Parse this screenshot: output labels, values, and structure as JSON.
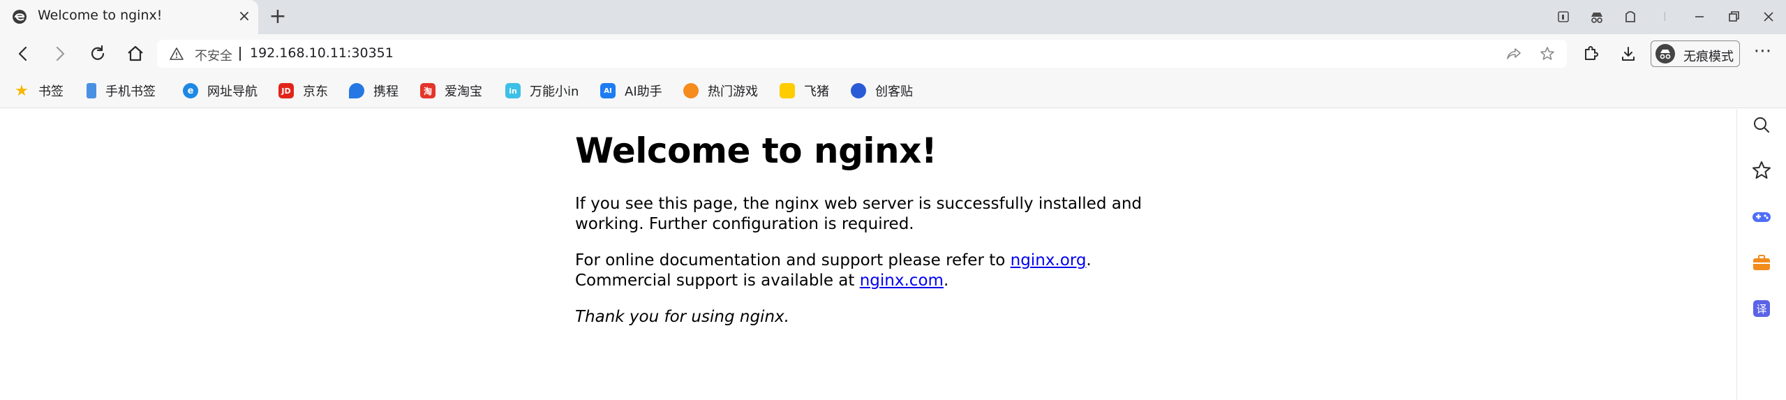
{
  "window": {
    "tab": {
      "title": "Welcome to nginx!",
      "favicon": "edge-favicon-icon",
      "close": "×"
    },
    "new_tab": "+",
    "controls": [
      "workspaces-icon",
      "incognito-mask-icon",
      "extensions-icon",
      "minimize-icon",
      "restore-icon",
      "close-window-icon"
    ]
  },
  "toolbar": {
    "insecure_label": "不安全",
    "url": "192.168.10.11:30351",
    "incognito_label": "无痕模式",
    "more": "⋯"
  },
  "bookmarks": [
    {
      "label": "书签",
      "icon": "star-icon",
      "color": "#f5b700",
      "glyph": "★"
    },
    {
      "label": "手机书签",
      "icon": "phone-bookmark-icon",
      "color": "#4a90e2",
      "glyph": ""
    },
    {
      "label": "网址导航",
      "icon": "edge-icon",
      "color": "#1e88e5",
      "glyph": "e"
    },
    {
      "label": "京东",
      "icon": "jd-icon",
      "color": "#e1251b",
      "glyph": "JD"
    },
    {
      "label": "携程",
      "icon": "ctrip-icon",
      "color": "#2577e3",
      "glyph": ""
    },
    {
      "label": "爱淘宝",
      "icon": "taobao-icon",
      "color": "#e3352b",
      "glyph": "淘"
    },
    {
      "label": "万能小in",
      "icon": "in-icon",
      "color": "#3cc0e6",
      "glyph": "in"
    },
    {
      "label": "AI助手",
      "icon": "ai-assistant-icon",
      "color": "#1d7cf2",
      "glyph": "AI"
    },
    {
      "label": "热门游戏",
      "icon": "games-icon",
      "color": "#f68b1e",
      "glyph": ""
    },
    {
      "label": "飞猪",
      "icon": "fliggy-icon",
      "color": "#ffcc00",
      "glyph": ""
    },
    {
      "label": "创客贴",
      "icon": "chuangkit-icon",
      "color": "#2a5bd7",
      "glyph": ""
    }
  ],
  "page": {
    "heading": "Welcome to nginx!",
    "para1_line1": "If you see this page, the nginx web server is successfully installed and",
    "para1_line2": "working. Further configuration is required.",
    "para2_line1_prefix": "For online documentation and support please refer to ",
    "para2_link1": "nginx.org",
    "para2_line1_suffix": ".",
    "para2_line2_prefix": "Commercial support is available at ",
    "para2_link2": "nginx.com",
    "para2_line2_suffix": ".",
    "para3": "Thank you for using nginx."
  },
  "sidebar": [
    "search-icon",
    "favorites-star-icon",
    "gamepad-icon",
    "toolbox-icon",
    "translate-icon"
  ],
  "colors": {
    "link": "#0000ee",
    "tabstrip": "#dee1e6",
    "toolbar": "#f7f7f7"
  }
}
